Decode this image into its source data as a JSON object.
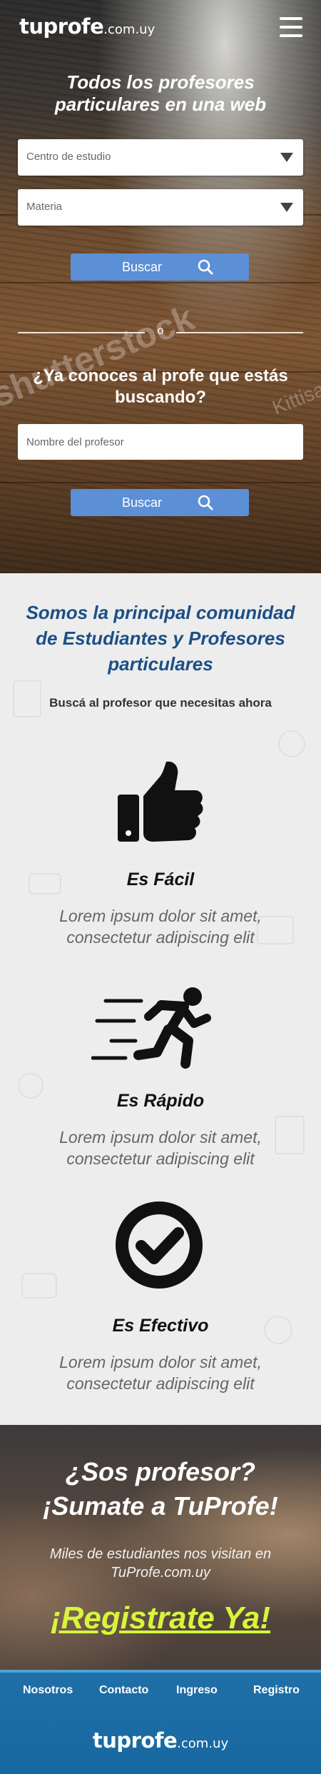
{
  "header": {
    "logo_main": "tuprofe",
    "logo_domain": ".com.uy"
  },
  "hero": {
    "title": "Todos los profesores particulares en una web",
    "select_centro": "Centro de estudio",
    "select_materia": "Materia",
    "search_label": "Buscar",
    "or_label": "o",
    "question": "¿Ya conoces al profe que estás buscando?",
    "name_placeholder": "Nombre del profesor",
    "search_label_2": "Buscar",
    "watermark": "shutterstock",
    "watermark_2": "Kittisak"
  },
  "community": {
    "title": "Somos la principal comunidad de Estudiantes y Profesores particulares",
    "subtitle": "Buscá al profesor que necesitas ahora",
    "features": [
      {
        "icon": "thumbs-up-icon",
        "title": "Es Fácil",
        "text": "Lorem ipsum dolor sit amet, consectetur adipiscing elit"
      },
      {
        "icon": "running-man-icon",
        "title": "Es Rápido",
        "text": "Lorem ipsum dolor sit amet, consectetur adipiscing elit"
      },
      {
        "icon": "check-circle-icon",
        "title": "Es Efectivo",
        "text": "Lorem ipsum dolor sit amet, consectetur adipiscing elit"
      }
    ]
  },
  "cta": {
    "title_line1": "¿Sos profesor?",
    "title_line2": "¡Sumate a TuProfe!",
    "text": "Miles de estudiantes nos visitan en TuProfe.com.uy",
    "link": "¡Registrate Ya!"
  },
  "footer": {
    "nav": [
      "Nosotros",
      "Contacto",
      "Ingreso",
      "Registro"
    ],
    "logo_main": "tuprofe",
    "logo_domain": ".com.uy"
  },
  "colors": {
    "brand_blue": "#1c4f86",
    "button_blue": "#5b8fd6",
    "footer_blue": "#1767a0",
    "cta_accent": "#d7f53a"
  }
}
